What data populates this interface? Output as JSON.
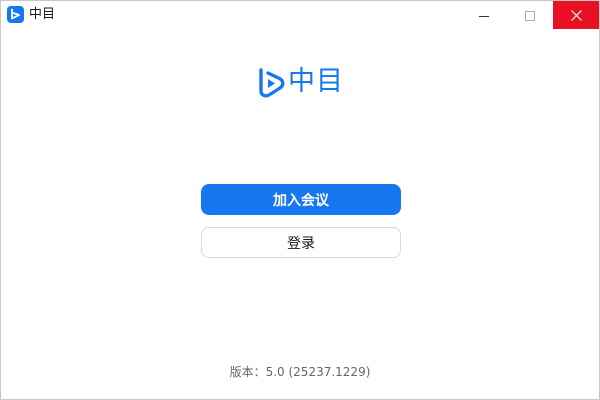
{
  "window": {
    "title": "中目",
    "app_icon": "zhongmu-logo-icon",
    "controls": {
      "minimize_icon": "minimize-icon",
      "maximize_icon": "maximize-icon",
      "close_icon": "close-icon"
    }
  },
  "logo": {
    "icon": "zhongmu-logo-icon",
    "text": "中目"
  },
  "actions": {
    "join_meeting_label": "加入会议",
    "login_label": "登录"
  },
  "footer": {
    "version": "版本：5.0 (25237.1229)"
  },
  "colors": {
    "accent": "#1677ee",
    "close_hover": "#e81123",
    "border": "#d9d9d9",
    "text_secondary": "#666666"
  }
}
